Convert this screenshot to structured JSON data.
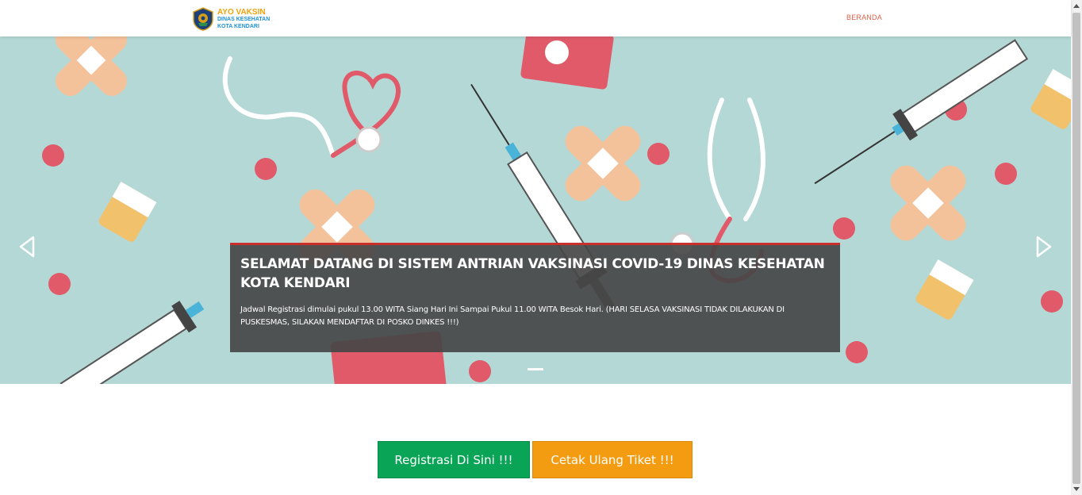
{
  "brand": {
    "line1": "AYO VAKSIN",
    "line2": "DINAS KESEHATAN",
    "line3": "KOTA KENDARI",
    "logo_icon": "government-emblem-icon"
  },
  "nav": {
    "beranda": "BERANDA"
  },
  "hero": {
    "title": "SELAMAT DATANG DI SISTEM ANTRIAN VAKSINASI COVID-19 DINAS KESEHATAN KOTA KENDARI",
    "text": "Jadwal Registrasi dimulai pukul 13.00 WITA Siang Hari Ini Sampai Pukul 11.00 WITA Besok Hari. (HARI SELASA VAKSINASI TIDAK DILAKUKAN DI PUSKESMAS, SILAKAN MENDAFTAR DI POSKO DINKES !!!)",
    "background_color": "#b4d8d5"
  },
  "buttons": {
    "register": "Registrasi Di Sini !!!",
    "reprint": "Cetak Ulang Tiket !!!"
  },
  "colors": {
    "accent_green": "#0aa457",
    "accent_orange": "#f39c12",
    "nav_link": "#e0604a",
    "caption_border": "#c9302c"
  }
}
